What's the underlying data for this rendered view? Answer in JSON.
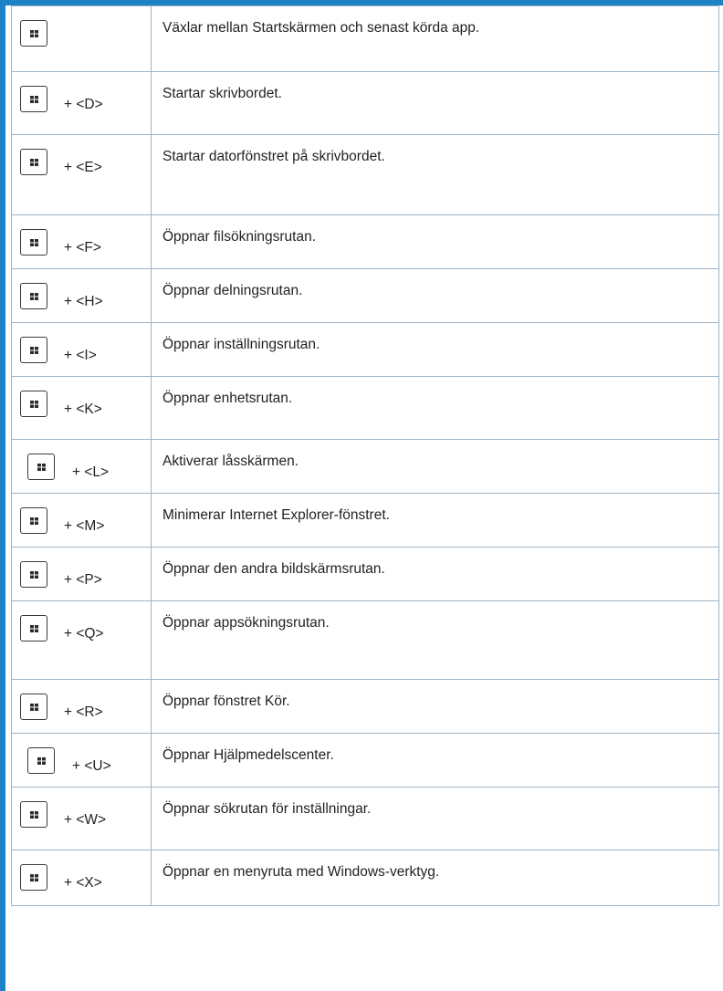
{
  "colors": {
    "accent": "#1e82c7",
    "border": "#9fb3c4",
    "text": "#231f20"
  },
  "rows": [
    {
      "key": "",
      "description": "Växlar mellan Startskärmen och senast körda app."
    },
    {
      "key": "+ <D>",
      "description": "Startar skrivbordet."
    },
    {
      "key": "+ <E>",
      "description": "Startar datorfönstret på skrivbordet."
    },
    {
      "key": "+ <F>",
      "description": "Öppnar filsökningsrutan."
    },
    {
      "key": "+ <H>",
      "description": "Öppnar delningsrutan."
    },
    {
      "key": "+ <I>",
      "description": "Öppnar inställningsrutan."
    },
    {
      "key": "+ <K>",
      "description": "Öppnar enhetsrutan."
    },
    {
      "key": "+ <L>",
      "description": "Aktiverar låsskärmen."
    },
    {
      "key": "+ <M>",
      "description": "Minimerar Internet Explorer-fönstret."
    },
    {
      "key": "+ <P>",
      "description": "Öppnar den andra bildskärmsrutan."
    },
    {
      "key": "+ <Q>",
      "description": "Öppnar appsökningsrutan."
    },
    {
      "key": "+ <R>",
      "description": "Öppnar fönstret Kör."
    },
    {
      "key": "+ <U>",
      "description": "Öppnar Hjälpmedelscenter."
    },
    {
      "key": "+ <W>",
      "description": "Öppnar sökrutan för inställningar."
    },
    {
      "key": "+ <X>",
      "description": "Öppnar en menyruta med Windows-verktyg."
    }
  ],
  "icon": "windows-key-icon"
}
